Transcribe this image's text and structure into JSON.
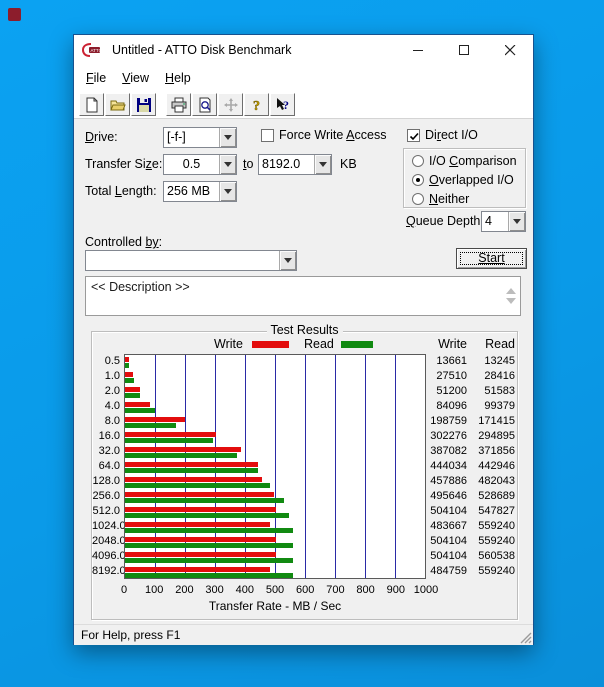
{
  "desktop": {
    "wallpaper_color": "#0a9bea",
    "badge_color": "#8c1d2c"
  },
  "window": {
    "title": "Untitled - ATTO Disk Benchmark",
    "menu": [
      "File",
      "View",
      "Help"
    ],
    "toolbar_icons": [
      "new",
      "open",
      "save",
      "print",
      "print-preview",
      "pan",
      "help",
      "context-help"
    ],
    "status_bar": "For Help, press F1"
  },
  "controls": {
    "drive_label": "Drive:",
    "drive_value": "[-f-]",
    "force_write_access_label": "Force Write Access",
    "force_write_access_checked": false,
    "direct_io_label": "Direct I/O",
    "direct_io_checked": true,
    "transfer_size_label": "Transfer Size:",
    "transfer_from_value": "0.5",
    "to_label": "to",
    "transfer_to_value": "8192.0",
    "kb_label": "KB",
    "total_length_label": "Total Length:",
    "total_length_value": "256 MB",
    "radio_options": [
      "I/O Comparison",
      "Overlapped I/O",
      "Neither"
    ],
    "radio_selected": "Overlapped I/O",
    "queue_depth_label": "Queue Depth:",
    "queue_depth_value": "4",
    "controlled_by_label": "Controlled by:",
    "controlled_by_value": "",
    "start_button": "Start",
    "description_text": "<< Description >>"
  },
  "chart_data": {
    "type": "bar",
    "orientation": "horizontal",
    "title": "Test Results",
    "categories": [
      "0.5",
      "1.0",
      "2.0",
      "4.0",
      "8.0",
      "16.0",
      "32.0",
      "64.0",
      "128.0",
      "256.0",
      "512.0",
      "1024.0",
      "2048.0",
      "4096.0",
      "8192.0"
    ],
    "series": [
      {
        "name": "Write",
        "color": "#e30d0d",
        "values": [
          13661,
          27510,
          51200,
          84096,
          198759,
          302276,
          387082,
          444034,
          457886,
          495646,
          504104,
          483667,
          504104,
          504104,
          484759
        ]
      },
      {
        "name": "Read",
        "color": "#118a11",
        "values": [
          13245,
          28416,
          51583,
          99379,
          171415,
          294895,
          371856,
          442946,
          482043,
          528689,
          547827,
          559240,
          559240,
          560538,
          559240
        ]
      }
    ],
    "column_headers": [
      "Write",
      "Read"
    ],
    "xlabel": "Transfer Rate - MB / Sec",
    "x_ticks": [
      0,
      100,
      200,
      300,
      400,
      500,
      600,
      700,
      800,
      900,
      1000
    ],
    "xlim_mb_per_sec": [
      0,
      1000
    ],
    "values_unit": "KB/s (bar length = value / 1000 MB/s)",
    "gridlines": "vertical, every 100 MB/s",
    "gridline_color": "#2a2aa6",
    "legend_position": "top"
  }
}
